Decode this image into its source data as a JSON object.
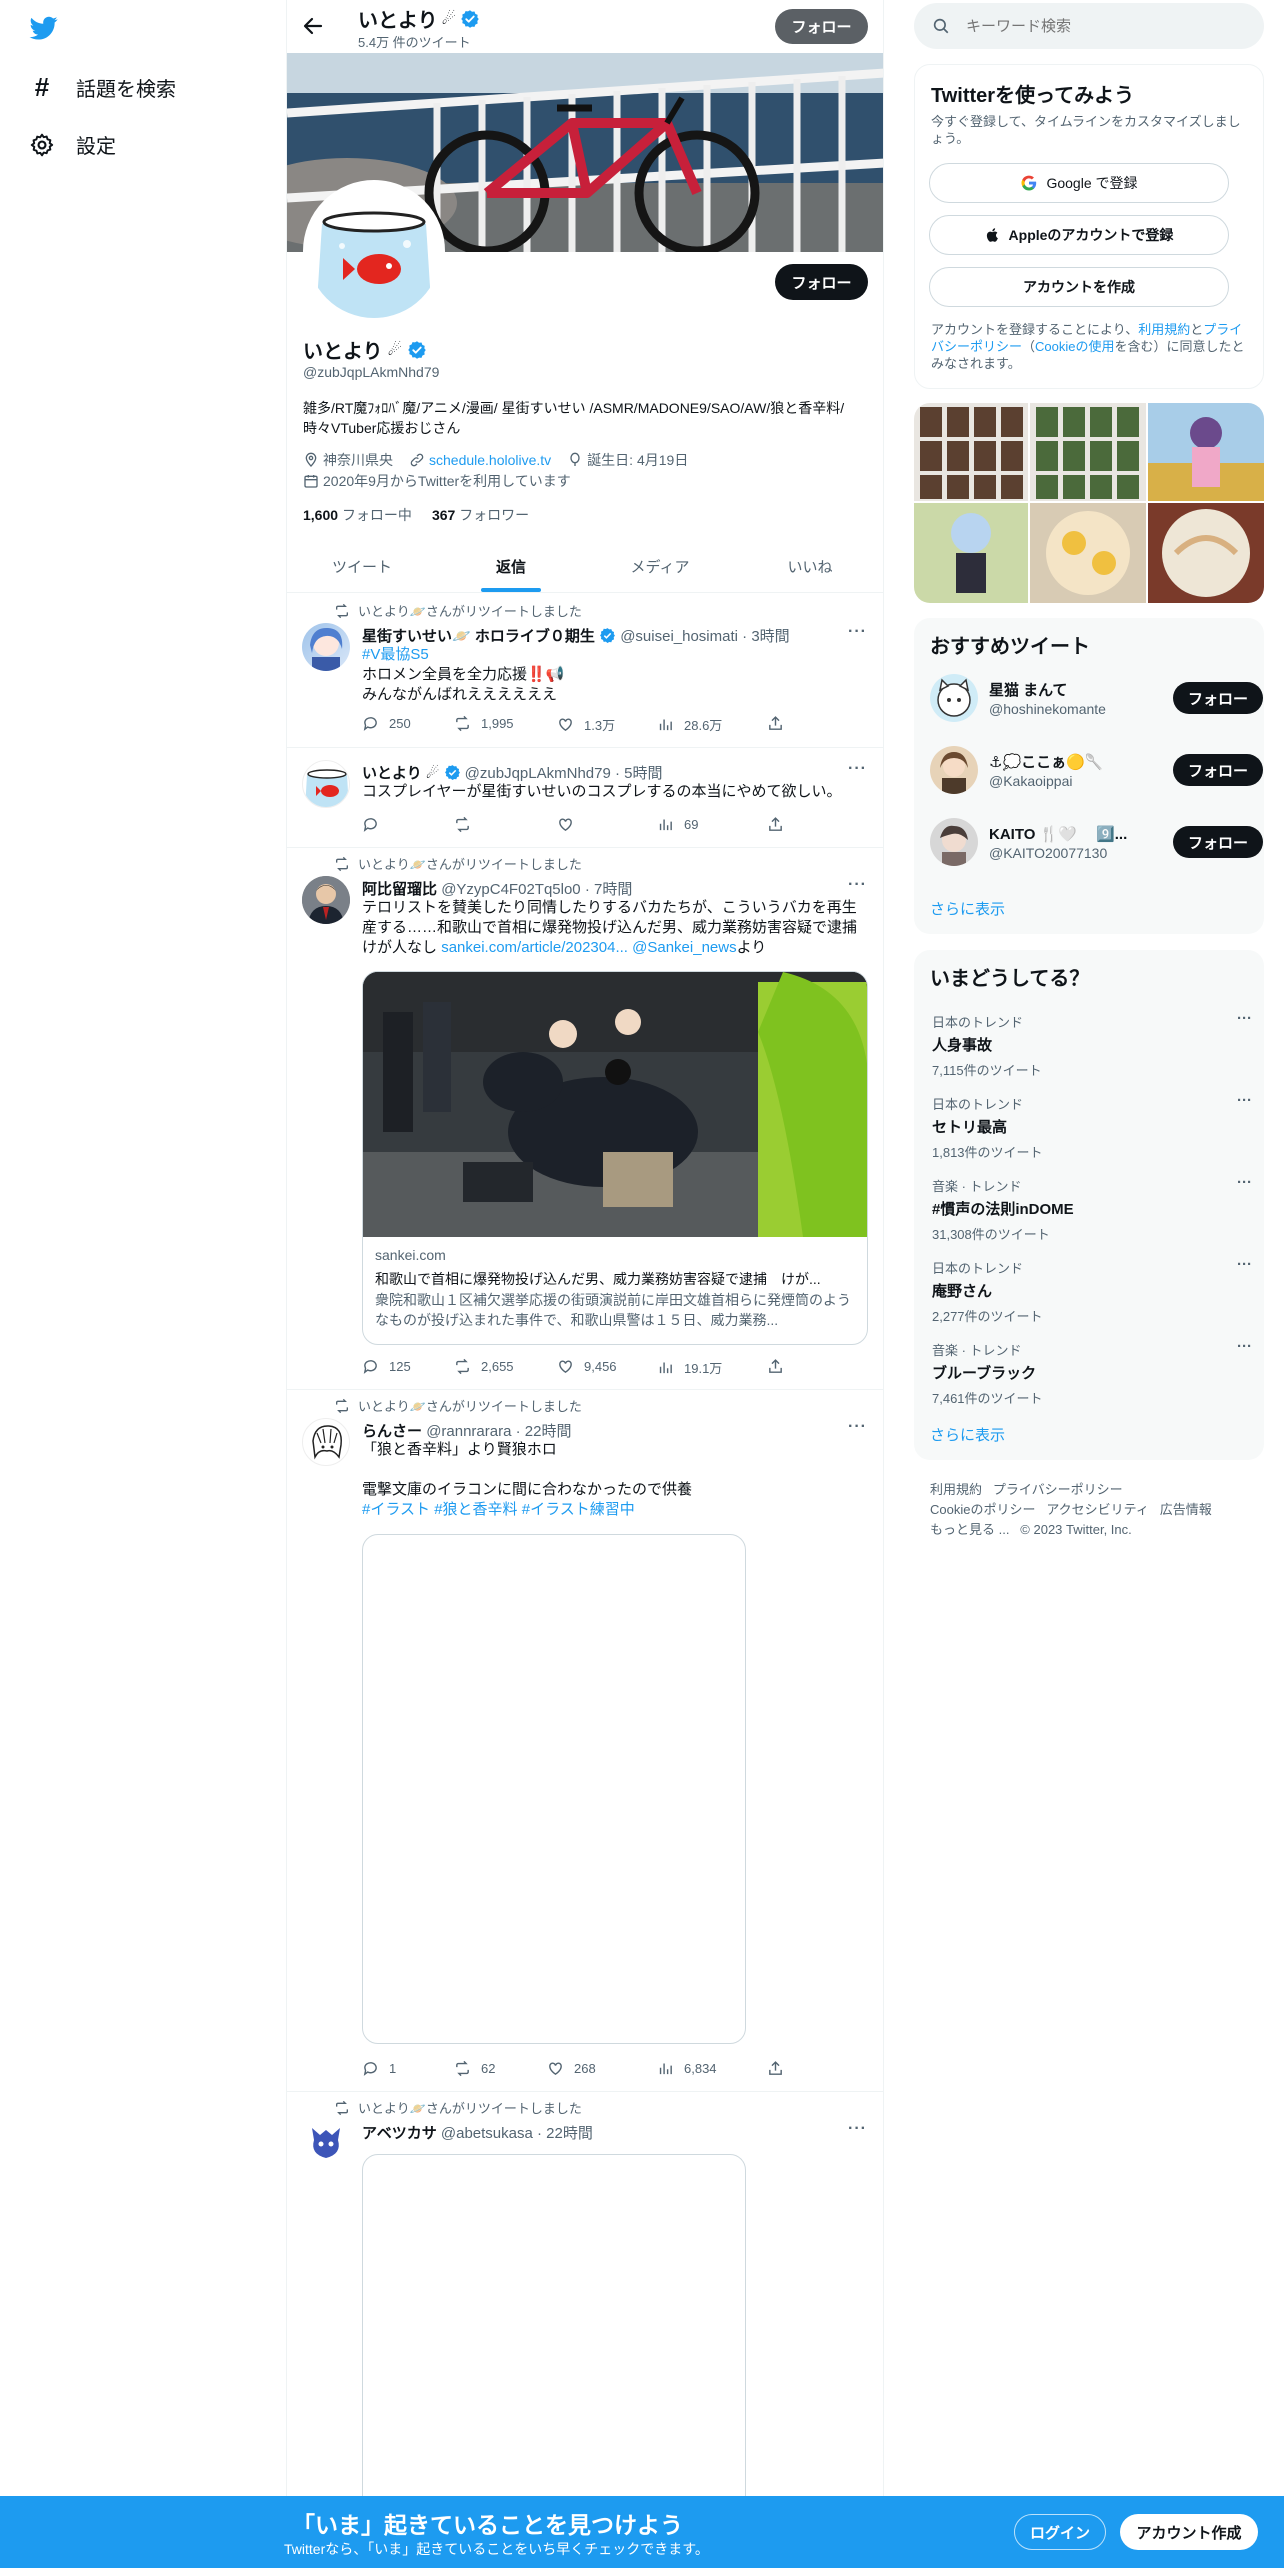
{
  "nav": {
    "explore_label": "話題を検索",
    "settings_label": "設定"
  },
  "header": {
    "name": "いとより",
    "tweet_count": "5.4万 件のツイート",
    "follow_label": "フォロー"
  },
  "profile": {
    "name": "いとより",
    "handle": "@zubJqpLAkmNhd79",
    "follow_label": "フォロー",
    "bio": "雑多/RT魔ﾌｫﾛﾊﾞ魔/アニメ/漫画/ 星街すいせい /ASMR/MADONE9/SAO/AW/狼と香辛料/時々VTuber応援おじさん",
    "location": "神奈川県央",
    "website": "schedule.hololive.tv",
    "birthday": "誕生日: 4月19日",
    "joined": "2020年9月からTwitterを利用しています",
    "following_count": "1,600",
    "following_label": "フォロー中",
    "followers_count": "367",
    "followers_label": "フォロワー"
  },
  "tabs": [
    "ツイート",
    "返信",
    "メディア",
    "いいね"
  ],
  "tweets": [
    {
      "retweet_label": "いとより🪐さんがリツイートしました",
      "name": "星街すいせい🪐 ホロライブ０期生",
      "handle": "@suisei_hosimati",
      "time": "3時間",
      "hashtag": "#V最協S5",
      "line1": "ホロメン全員を全力応援‼️📢",
      "line2": "みんながんばれええええええ",
      "replies": "250",
      "retweets": "1,995",
      "likes": "1.3万",
      "views": "28.6万"
    },
    {
      "name": "いとより",
      "handle": "@zubJqpLAkmNhd79",
      "time": "5時間",
      "text": "コスプレイヤーが星街すいせいのコスプレするの本当にやめて欲しい。",
      "views": "69"
    },
    {
      "retweet_label": "いとより🪐さんがリツイートしました",
      "name": "阿比留瑠比",
      "handle": "@YzypC4F02Tq5lo0",
      "time": "7時間",
      "text": "テロリストを賛美したり同情したりするバカたちが、こういうバカを再生産する……和歌山で首相に爆発物投げ込んだ男、威力業務妨害容疑で逮捕 けが人なし",
      "link": "sankei.com/article/202304...",
      "mention": "@Sankei_news",
      "via": "より",
      "card_domain": "sankei.com",
      "card_title": "和歌山で首相に爆発物投げ込んだ男、威力業務妨害容疑で逮捕　けが...",
      "card_desc": "衆院和歌山１区補欠選挙応援の街頭演説前に岸田文雄首相らに発煙筒のようなものが投げ込まれた事件で、和歌山県警は１５日、威力業務...",
      "replies": "125",
      "retweets": "2,655",
      "likes": "9,456",
      "views": "19.1万"
    },
    {
      "retweet_label": "いとより🪐さんがリツイートしました",
      "name": "らんさー",
      "handle": "@rannrarara",
      "time": "22時間",
      "line1": "「狼と香辛料」より賢狼ホロ",
      "line2": "電撃文庫のイラコンに間に合わなかったので供養",
      "tags": "#イラスト #狼と香辛料 #イラスト練習中",
      "replies": "1",
      "retweets": "62",
      "likes": "268",
      "views": "6,834"
    },
    {
      "retweet_label": "いとより🪐さんがリツイートしました",
      "name": "アベツカサ",
      "handle": "@abetsukasa",
      "time": "22時間"
    }
  ],
  "search": {
    "placeholder": "キーワード検索"
  },
  "signup": {
    "title": "Twitterを使ってみよう",
    "subtitle": "今すぐ登録して、タイムラインをカスタマイズしましょう。",
    "google_label": "Google で登録",
    "apple_label": "Appleのアカウントで登録",
    "create_label": "アカウントを作成",
    "terms_pre": "アカウントを登録することにより、",
    "terms_link": "利用規約",
    "terms_and": "と",
    "privacy_link": "プライバシーポリシー",
    "cookie_open": "（",
    "cookie_link": "Cookieの使用",
    "cookie_close": "を含む）に同意したとみなされます。"
  },
  "recommended": {
    "title": "おすすめツイート",
    "users": [
      {
        "name": "星猫 まんて",
        "handle": "@hoshinekomante",
        "follow": "フォロー"
      },
      {
        "name": "⚓💭ここぁ🟡🥄",
        "handle": "@Kakaoippai",
        "follow": "フォロー"
      },
      {
        "name": "KAITO 🍴🤍 　9️⃣...",
        "handle": "@KAITO20077130",
        "follow": "フォロー"
      }
    ],
    "more": "さらに表示"
  },
  "trends": {
    "title": "いまどうしてる？",
    "items": [
      {
        "meta": "日本のトレンド",
        "name": "人身事故",
        "count": "7,115件のツイート"
      },
      {
        "meta": "日本のトレンド",
        "name": "セトリ最高",
        "count": "1,813件のツイート"
      },
      {
        "meta": "音楽 · トレンド",
        "name": "#慣声の法則inDOME",
        "count": "31,308件のツイート"
      },
      {
        "meta": "日本のトレンド",
        "name": "庵野さん",
        "count": "2,277件のツイート"
      },
      {
        "meta": "音楽 · トレンド",
        "name": "ブルーブラック",
        "count": "7,461件のツイート"
      }
    ],
    "more": "さらに表示"
  },
  "footer": {
    "terms": "利用規約",
    "privacy": "プライバシーポリシー",
    "cookie": "Cookieのポリシー",
    "accessibility": "アクセシビリティ",
    "ads": "広告情報",
    "more": "もっと見る ...",
    "copyright": "© 2023 Twitter, Inc."
  },
  "bottom": {
    "title": "「いま」起きていることを見つけよう",
    "subtitle": "Twitterなら、「いま」起きていることをいち早くチェックできます。",
    "login": "ログイン",
    "signup": "アカウント作成"
  },
  "colors": {
    "accent": "#1d9bf0",
    "text": "#0f1419",
    "muted": "#536471",
    "card_bg": "#f7f9f9"
  }
}
